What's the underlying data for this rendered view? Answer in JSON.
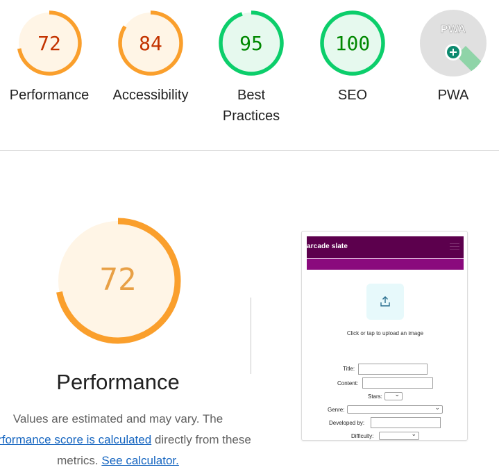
{
  "colors": {
    "average_arc": "#fa9f2c",
    "average_fill": "#fff5e6",
    "average_text": "#c33300",
    "pass_arc": "#0cce6b",
    "pass_fill": "#e6f9ee",
    "pass_text": "#008800",
    "pwa_fill": "#e0e0e0",
    "thumb_nav": "#5c004d",
    "thumb_bar": "#8a0a7d"
  },
  "scores": [
    {
      "label": "Performance",
      "score": 72,
      "rating": "average"
    },
    {
      "label": "Accessibility",
      "score": 84,
      "rating": "average"
    },
    {
      "label": "Best Practices",
      "score": 95,
      "rating": "pass"
    },
    {
      "label": "SEO",
      "score": 100,
      "rating": "pass"
    },
    {
      "label": "PWA",
      "score": null,
      "rating": "pwa",
      "badge_text": "PWA",
      "icon": "plus-circle-icon"
    }
  ],
  "performance": {
    "score": 72,
    "title": "Performance",
    "desc_prefix": "Values are estimated and may vary. The ",
    "desc_link1": "performance score is calculated",
    "desc_middle": " directly from these metrics. ",
    "desc_link2": "See calculator."
  },
  "thumbnail": {
    "brand": "arcade slate",
    "upload_icon": "upload-icon",
    "upload_text": "Click or tap to upload an image",
    "fields": {
      "title": "Title:",
      "content": "Content:",
      "stars": "Stars:",
      "genre": "Genre:",
      "developed_by": "Developed by:",
      "difficulty": "Difficulty:"
    }
  }
}
